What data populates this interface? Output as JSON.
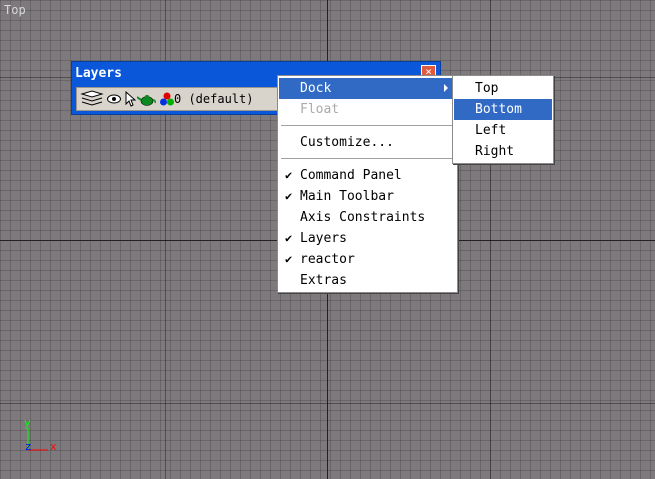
{
  "viewport": {
    "label": "Top"
  },
  "layers_toolbar": {
    "title": "Layers",
    "close_glyph": "×",
    "current_layer": "0 (default)",
    "icons": [
      "layer-stack-icon",
      "eye-icon",
      "cursor-icon",
      "teapot-icon",
      "rgb-dots-icon"
    ]
  },
  "context_menu": {
    "dock": "Dock",
    "float": "Float",
    "customize": "Customize...",
    "command_panel": "Command Panel",
    "main_toolbar": "Main Toolbar",
    "axis_constraints": "Axis Constraints",
    "layers": "Layers",
    "reactor": "reactor",
    "extras": "Extras",
    "check_glyph": "✔",
    "checked": [
      "command_panel",
      "main_toolbar",
      "layers",
      "reactor"
    ]
  },
  "dock_submenu": {
    "top": "Top",
    "bottom": "Bottom",
    "left": "Left",
    "right": "Right",
    "highlighted": "bottom"
  },
  "axis_gizmo": {
    "x": "x",
    "y": "y",
    "z": "z"
  },
  "colors": {
    "viewport_bg": "#7d797d",
    "title_bar": "#0a57d9",
    "highlight": "#316ac5",
    "axis_x": "#ff0000",
    "axis_y": "#00ff00",
    "axis_z": "#0000ff"
  }
}
